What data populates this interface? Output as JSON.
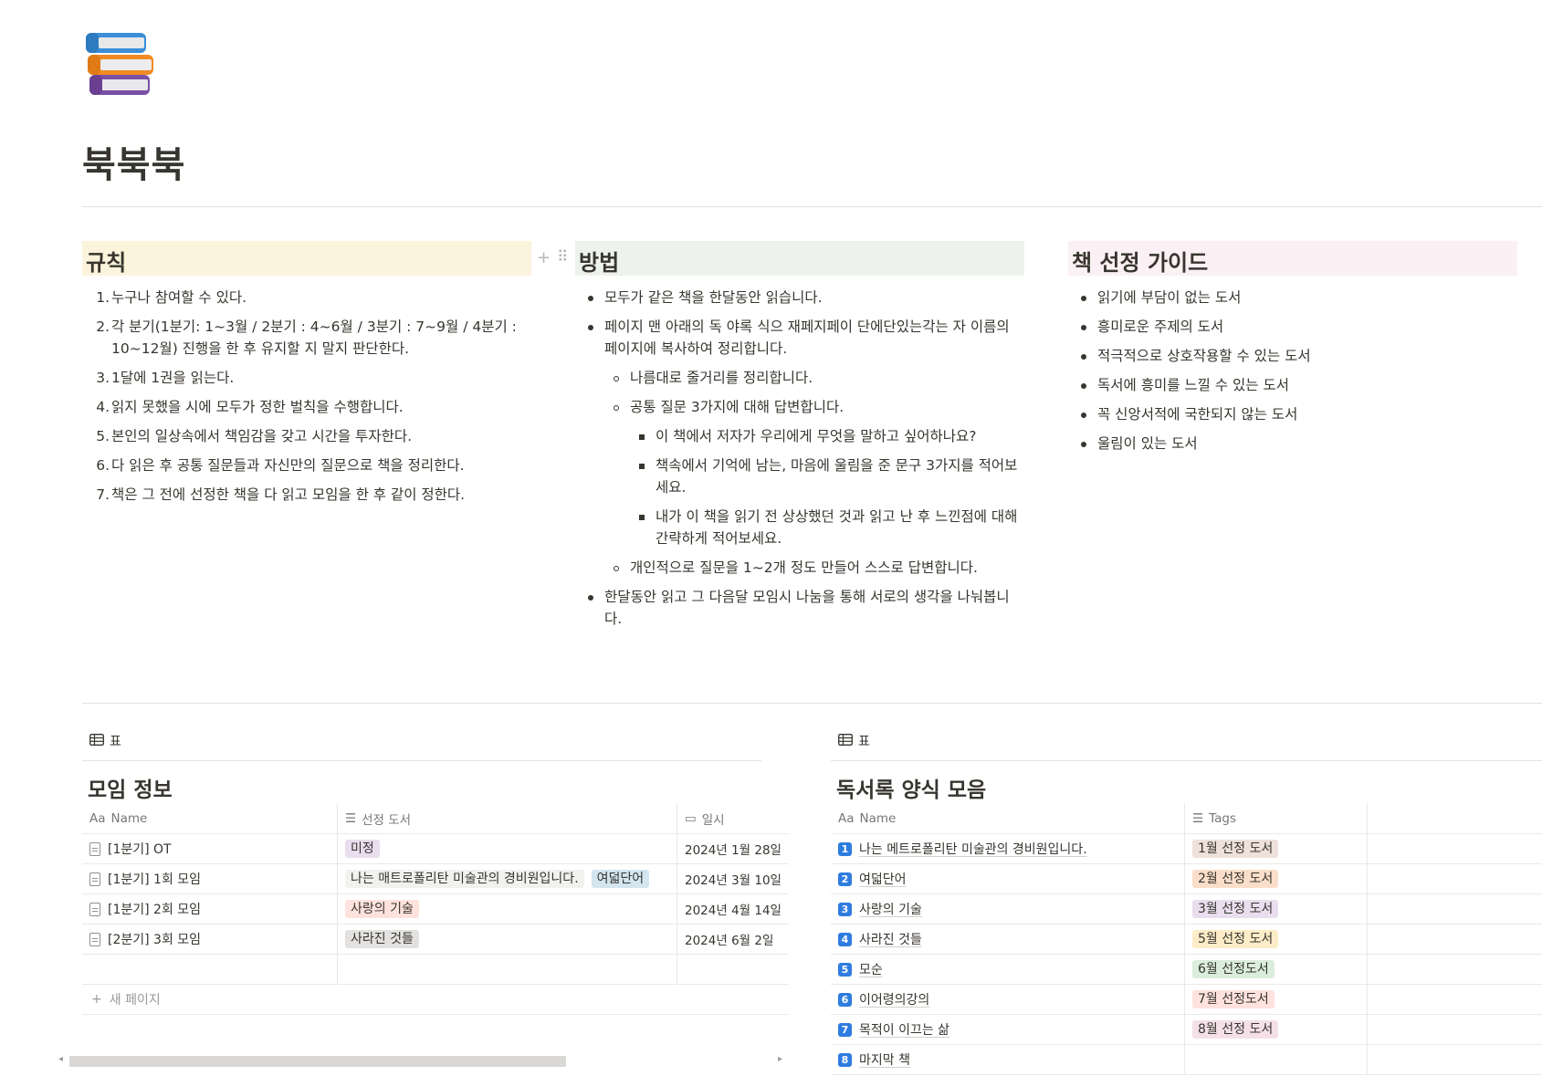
{
  "page": {
    "icon": "books-stack-icon",
    "title": "북북북"
  },
  "columns": {
    "rules": {
      "heading": "규칙",
      "items": [
        "누구나 참여할 수 있다.",
        "각 분기(1분기: 1~3월 / 2분기 : 4~6월 / 3분기 : 7~9월 / 4분기 : 10~12월) 진행을 한 후 유지할 지 말지 판단한다.",
        "1달에 1권을 읽는다.",
        "읽지 못했을 시에 모두가 정한 벌칙을 수행합니다.",
        "본인의 일상속에서 책임감을 갖고 시간을 투자한다.",
        "다 읽은 후 공통 질문들과 자신만의 질문으로 책을 정리한다.",
        "책은 그 전에 선정한 책을 다 읽고 모임을 한 후 같이 정한다."
      ]
    },
    "method": {
      "heading": "방법",
      "items": [
        "모두가 같은 책을 한달동안 읽습니다.",
        "페이지 맨 아래의 독 야록 식으 재페지페이 단에단있는각는 자 이름의 페이지에 복사하여 정리합니다.",
        "나름대로 줄거리를 정리합니다.",
        "공통 질문 3가지에 대해 답변합니다.",
        "이 책에서 저자가 우리에게 무엇을 말하고 싶어하나요?",
        "책속에서 기억에 남는, 마음에 울림을 준 문구 3가지를 적어보세요.",
        "내가 이 책을 읽기 전 상상했던 것과 읽고 난 후 느낀점에 대해 간략하게 적어보세요.",
        "개인적으로 질문을 1~2개 정도 만들어 스스로 답변합니다.",
        "한달동안 읽고 그 다음달 모임시 나눔을 통해 서로의 생각을 나눠봅니다."
      ]
    },
    "guide": {
      "heading": "책 선정 가이드",
      "items": [
        "읽기에 부담이 없는 도서",
        "흥미로운 주제의 도서",
        "적극적으로 상호작용할 수 있는 도서",
        "독서에 흥미를 느낄 수 있는 도서",
        "꼭 신앙서적에 국한되지 않는 도서",
        "울림이 있는 도서"
      ]
    }
  },
  "meetings": {
    "view_label": "표",
    "title": "모임 정보",
    "columns": {
      "name": "Name",
      "books": "선정 도서",
      "date": "일시"
    },
    "rows": [
      {
        "name": "[1분기] OT",
        "books": [
          "미정"
        ],
        "date": "2024년 1월 28일"
      },
      {
        "name": "[1분기] 1회 모임",
        "books": [
          "나는 매트로폴리탄 미술관의 경비원입니다.",
          "여덟단어"
        ],
        "date": "2024년 3월 10일"
      },
      {
        "name": "[1분기] 2회 모임",
        "books": [
          "사랑의 기술"
        ],
        "date": "2024년 4월 14일"
      },
      {
        "name": "[2분기] 3회 모임",
        "books": [
          "사라진 것들"
        ],
        "date": "2024년 6월 2일"
      }
    ],
    "new_page": "새 페이지"
  },
  "records": {
    "view_label": "표",
    "title": "독서록 양식 모음",
    "columns": {
      "name": "Name",
      "tags": "Tags"
    },
    "rows": [
      {
        "num": "1",
        "name": "나는 메트로폴리탄 미술관의 경비원입니다.",
        "tag": "1월 선정 도서"
      },
      {
        "num": "2",
        "name": "여덟단어",
        "tag": "2월 선정 도서"
      },
      {
        "num": "3",
        "name": "사랑의 기술",
        "tag": "3월 선정 도서"
      },
      {
        "num": "4",
        "name": "사라진 것들",
        "tag": "5월 선정 도서"
      },
      {
        "num": "5",
        "name": "모순",
        "tag": "6월 선정도서"
      },
      {
        "num": "6",
        "name": "이어령의강의",
        "tag": "7월 선정도서"
      },
      {
        "num": "7",
        "name": "목적이 이끄는 삶",
        "tag": "8월 선정 도서"
      },
      {
        "num": "8",
        "name": "마지막 책",
        "tag": ""
      }
    ]
  },
  "colors": {
    "rules_bg": "#fbf3db",
    "method_bg": "#edf3ec",
    "guide_bg": "#fbf0f3",
    "number_icon": "#2f7ce0"
  }
}
